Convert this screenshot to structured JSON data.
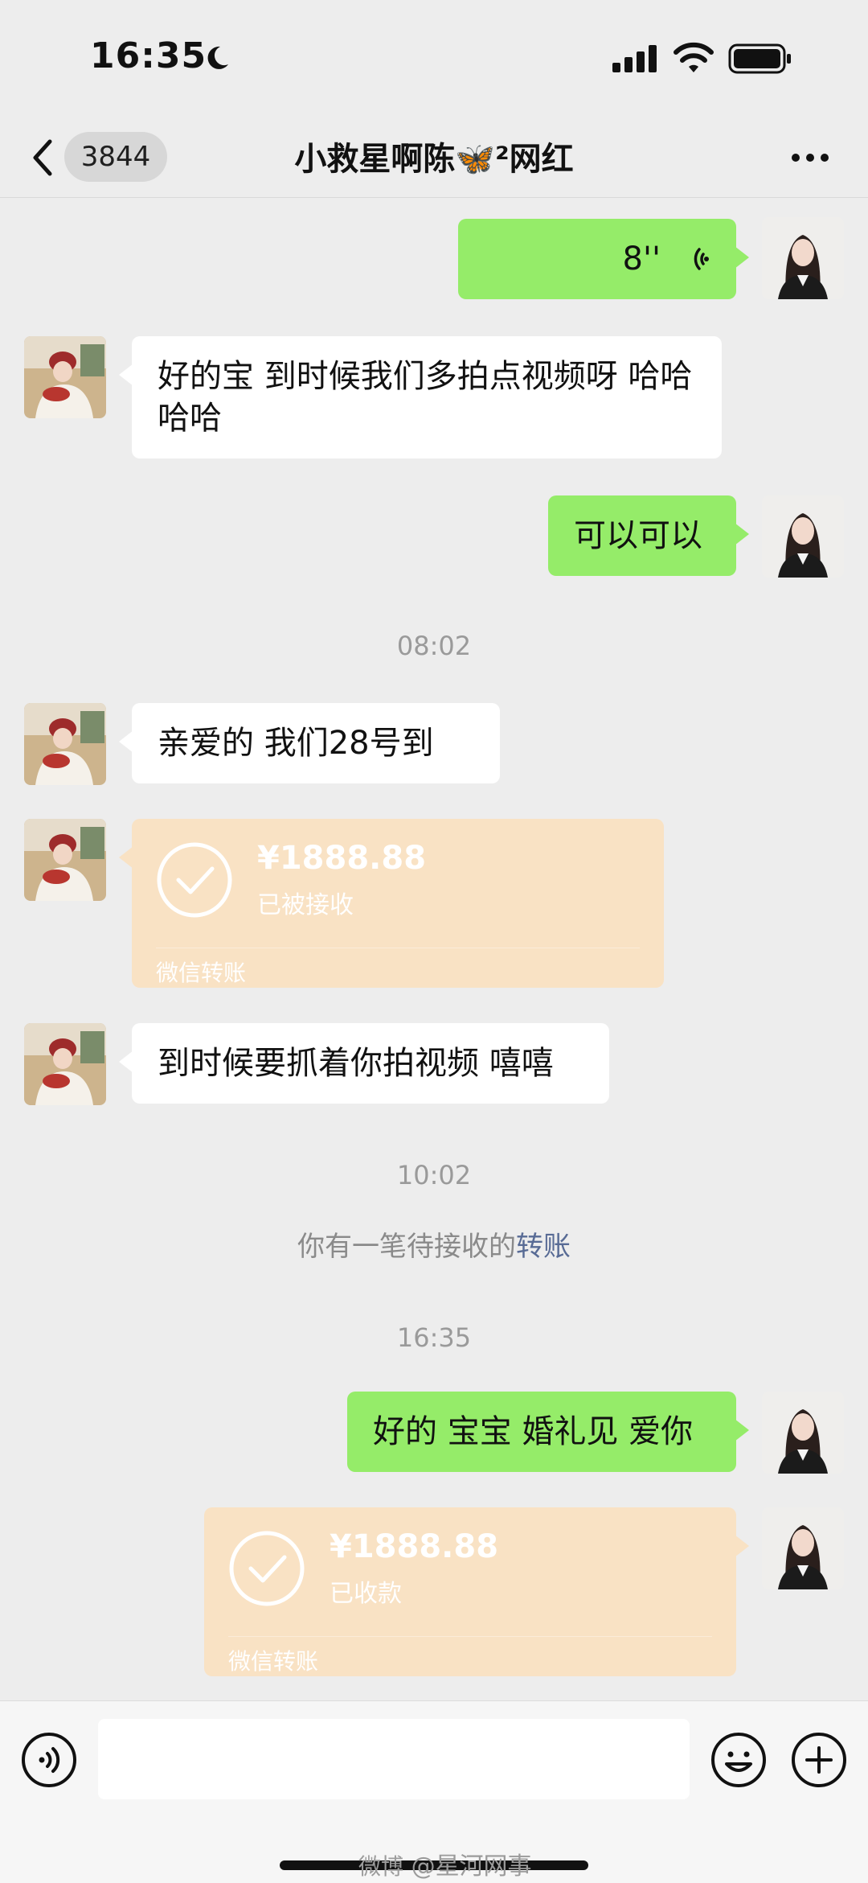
{
  "status_bar": {
    "time": "16:35"
  },
  "nav": {
    "unread_count": "3844",
    "title": "小救星啊陈🦋²网红"
  },
  "messages": {
    "voice": {
      "duration": "8''"
    },
    "m1": "好的宝 到时候我们多拍点视频呀 哈哈哈哈",
    "m2": "可以可以",
    "time1": "08:02",
    "m3": "亲爱的 我们28号到",
    "transfer1": {
      "amount": "¥1888.88",
      "status": "已被接收",
      "label": "微信转账"
    },
    "m4": "到时候要抓着你拍视频 嘻嘻",
    "time2": "10:02",
    "system_text": "你有一笔待接收的",
    "system_link": "转账",
    "time3": "16:35",
    "m5": "好的 宝宝 婚礼见 爱你",
    "transfer2": {
      "amount": "¥1888.88",
      "status": "已收款",
      "label": "微信转账"
    }
  },
  "watermark": {
    "logo": "微博",
    "text": "@星河网事"
  },
  "colors": {
    "me_bubble": "#95ec69",
    "other_bubble": "#ffffff",
    "transfer_card": "#f9e2c4",
    "background": "#ededed",
    "link": "#586b95"
  },
  "icons": [
    "moon-icon",
    "signal-icon",
    "wifi-icon",
    "battery-icon",
    "back-icon",
    "more-icon",
    "voice-wave-icon",
    "check-icon",
    "voice-toggle-icon",
    "emoji-icon",
    "plus-icon"
  ]
}
